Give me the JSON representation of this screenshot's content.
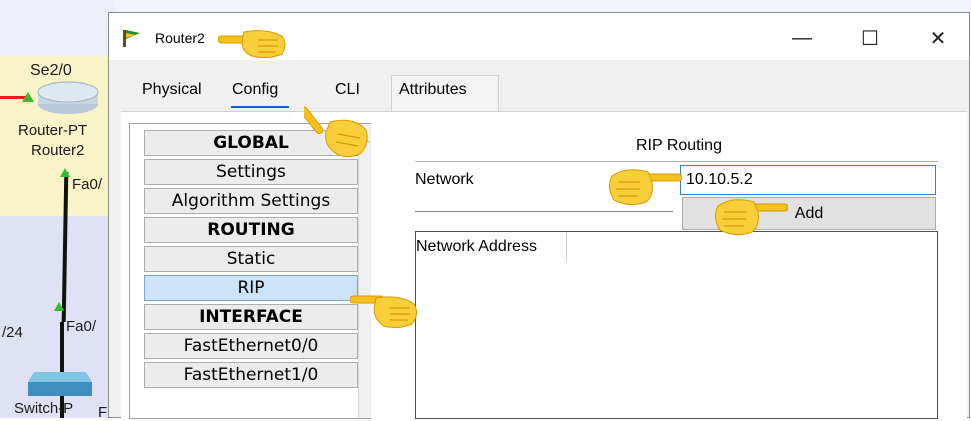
{
  "background": {
    "labels": {
      "se20": "Se2/0",
      "router_model": "Router-PT",
      "router_name": "Router2",
      "fa0_a": "Fa0/",
      "fa0_b": "Fa0/",
      "subnet": "/24",
      "switch": "Switch-P",
      "f_char": "F"
    }
  },
  "window": {
    "title": "Router2",
    "controls": {
      "minimize": "—",
      "maximize": "☐",
      "close": "✕"
    }
  },
  "tabs": [
    {
      "label": "Physical"
    },
    {
      "label": "Config",
      "active": true
    },
    {
      "label": "CLI"
    },
    {
      "label": "Attributes"
    }
  ],
  "sidebar": {
    "items": [
      {
        "label": "GLOBAL",
        "type": "header"
      },
      {
        "label": "Settings"
      },
      {
        "label": "Algorithm Settings"
      },
      {
        "label": "ROUTING",
        "type": "header"
      },
      {
        "label": "Static"
      },
      {
        "label": "RIP",
        "selected": true
      },
      {
        "label": "INTERFACE",
        "type": "header"
      },
      {
        "label": "FastEthernet0/0"
      },
      {
        "label": "FastEthernet1/0"
      }
    ]
  },
  "rip": {
    "title": "RIP Routing",
    "network_label": "Network",
    "network_value": "10.10.5.2",
    "add_label": "Add",
    "table_header": "Network Address"
  },
  "colors": {
    "accent": "#0a64c8",
    "selected_item": "#cce4f7",
    "hand": "#f5c21b"
  },
  "icons": [
    "router-icon",
    "pointing-hand-icon",
    "switch-icon",
    "router-device-icon"
  ]
}
